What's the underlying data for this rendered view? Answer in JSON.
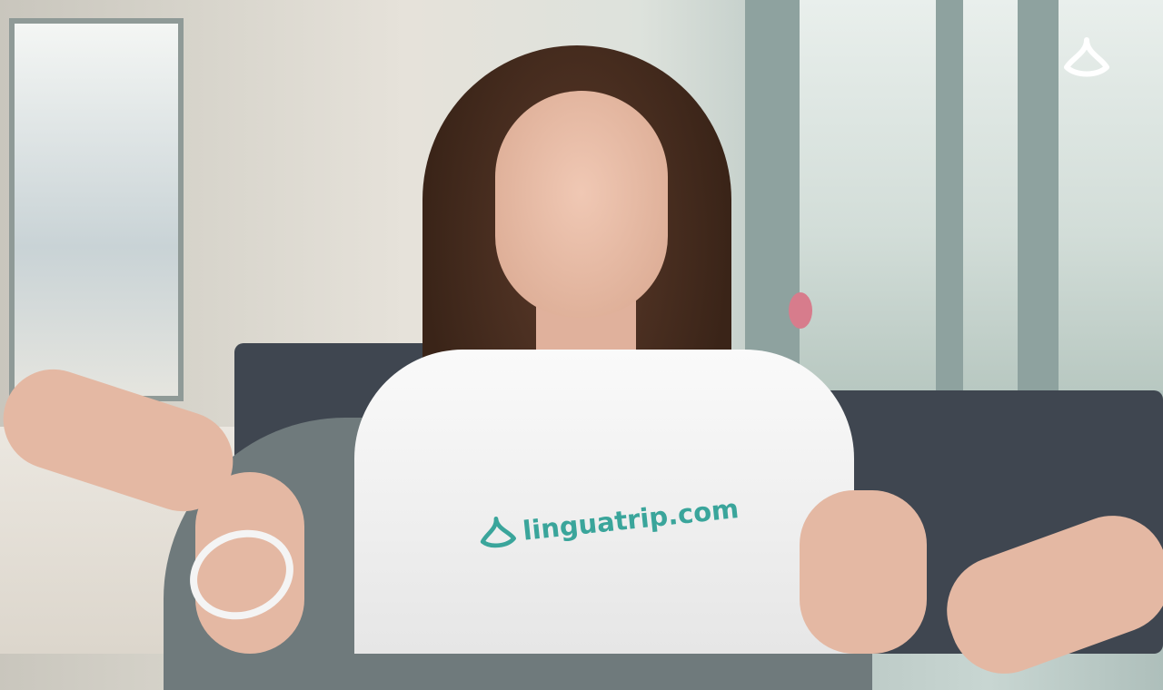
{
  "video_frame": {
    "channel_logo": "linguatrip-logo-icon",
    "shirt_text": "linguatrip.com",
    "brand_color": "#3aa59b"
  }
}
